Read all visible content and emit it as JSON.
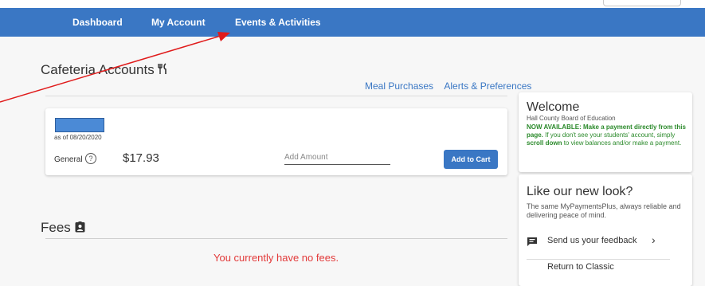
{
  "nav": {
    "items": [
      {
        "label": "Dashboard"
      },
      {
        "label": "My Account"
      },
      {
        "label": "Events & Activities"
      }
    ]
  },
  "cafeteria": {
    "title": "Cafeteria Accounts",
    "icon": "fork-knife-icon",
    "links": [
      "Meal Purchases",
      "Alerts & Preferences"
    ],
    "account": {
      "as_of": "as of 08/20/2020",
      "fund_label": "General",
      "balance": "$17.93",
      "amount_placeholder": "Add Amount",
      "add_to_cart": "Add to Cart"
    }
  },
  "fees": {
    "title": "Fees",
    "icon": "badge-icon",
    "empty_message": "You currently have no fees."
  },
  "welcome": {
    "title": "Welcome",
    "subtitle": "Hall County Board of Education",
    "highlight": "NOW AVAILABLE:",
    "message_bold": "Make a payment directly from this page.",
    "message_pre": "If you don't see your students' account, simply",
    "scroll_down": "scroll down",
    "message_post": "to view balances and/or make a payment."
  },
  "new_look": {
    "title": "Like our new look?",
    "body": "The same MyPaymentsPlus, always reliable and delivering peace of mind.",
    "feedback": "Send us your feedback",
    "return_classic": "Return to Classic"
  },
  "colors": {
    "primary": "#3a77c4",
    "error": "#e23a3a",
    "success": "#2b8a2b",
    "annotation_arrow": "#e01b1b"
  }
}
